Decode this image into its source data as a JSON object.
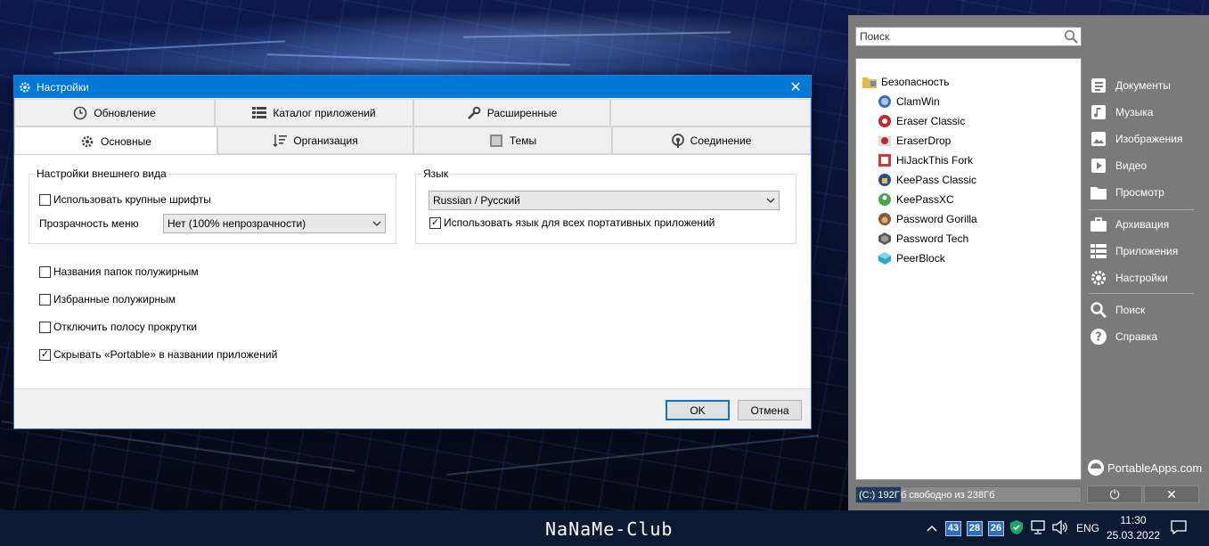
{
  "dialog": {
    "title": "Настройки",
    "tabs_row1": [
      {
        "label": "Обновление",
        "icon": "clock-icon"
      },
      {
        "label": "Каталог приложений",
        "icon": "grid-list-icon"
      },
      {
        "label": "Расширенные",
        "icon": "wrench-icon"
      },
      {
        "label": "",
        "icon": ""
      }
    ],
    "tabs_row2": [
      {
        "label": "Основные",
        "icon": "gear-icon"
      },
      {
        "label": "Организация",
        "icon": "sort-icon"
      },
      {
        "label": "Темы",
        "icon": "theme-icon"
      },
      {
        "label": "Соединение",
        "icon": "connection-icon"
      }
    ],
    "appearance": {
      "legend": "Настройки внешнего вида",
      "large_fonts_label": "Использовать крупные шрифты",
      "large_fonts_checked": false,
      "transparency_label": "Прозрачность меню",
      "transparency_value": "Нет (100% непрозрачности)"
    },
    "language": {
      "legend": "Язык",
      "value": "Russian / Русский",
      "apply_all_label": "Использовать язык для всех портативных приложений",
      "apply_all_checked": true
    },
    "options": [
      {
        "label": "Названия папок полужирным",
        "checked": false
      },
      {
        "label": "Избранные полужирным",
        "checked": false
      },
      {
        "label": "Отключить полосу прокрутки",
        "checked": false
      },
      {
        "label": "Скрывать «Portable» в названии приложений",
        "checked": true
      }
    ],
    "ok_label": "OK",
    "cancel_label": "Отмена"
  },
  "pa": {
    "search_placeholder": "Поиск",
    "category": "Безопасность",
    "apps": [
      {
        "label": "ClamWin",
        "icon": "clamwin-icon",
        "color": "#3b6fb5"
      },
      {
        "label": "Eraser Classic",
        "icon": "eraser-icon",
        "color": "#c0282d"
      },
      {
        "label": "EraserDrop",
        "icon": "eraserdrop-icon",
        "color": "#c0282d"
      },
      {
        "label": "HiJackThis Fork",
        "icon": "hijackthis-icon",
        "color": "#d23a3a"
      },
      {
        "label": "KeePass Classic",
        "icon": "keepass-icon",
        "color": "#2a4d8f"
      },
      {
        "label": "KeePassXC",
        "icon": "keepassxc-icon",
        "color": "#4aa44a"
      },
      {
        "label": "Password Gorilla",
        "icon": "gorilla-icon",
        "color": "#8a5a3a"
      },
      {
        "label": "Password Tech",
        "icon": "passwordtech-icon",
        "color": "#555555"
      },
      {
        "label": "PeerBlock",
        "icon": "peerblock-icon",
        "color": "#2aa6c8"
      }
    ],
    "nav": [
      {
        "label": "Документы",
        "icon": "documents-icon"
      },
      {
        "label": "Музыка",
        "icon": "music-icon"
      },
      {
        "label": "Изображения",
        "icon": "images-icon"
      },
      {
        "label": "Видео",
        "icon": "video-icon"
      },
      {
        "label": "Просмотр",
        "icon": "folder-icon"
      },
      {
        "label": "Архивация",
        "icon": "briefcase-icon"
      },
      {
        "label": "Приложения",
        "icon": "apps-list-icon"
      },
      {
        "label": "Настройки",
        "icon": "gear-icon"
      },
      {
        "label": "Поиск",
        "icon": "search-icon"
      },
      {
        "label": "Справка",
        "icon": "help-icon"
      }
    ],
    "brand": "PortableApps.com",
    "status_used": "(C:) 192Г",
    "status_rest": "б свободно из 238Гб",
    "power_glyph": "⏻",
    "close_glyph": "✕"
  },
  "taskbar": {
    "logo": "NaNaMe-Club",
    "badges": [
      "43",
      "28",
      "26"
    ],
    "lang": "ENG",
    "time": "11:30",
    "date": "25.03.2022"
  }
}
